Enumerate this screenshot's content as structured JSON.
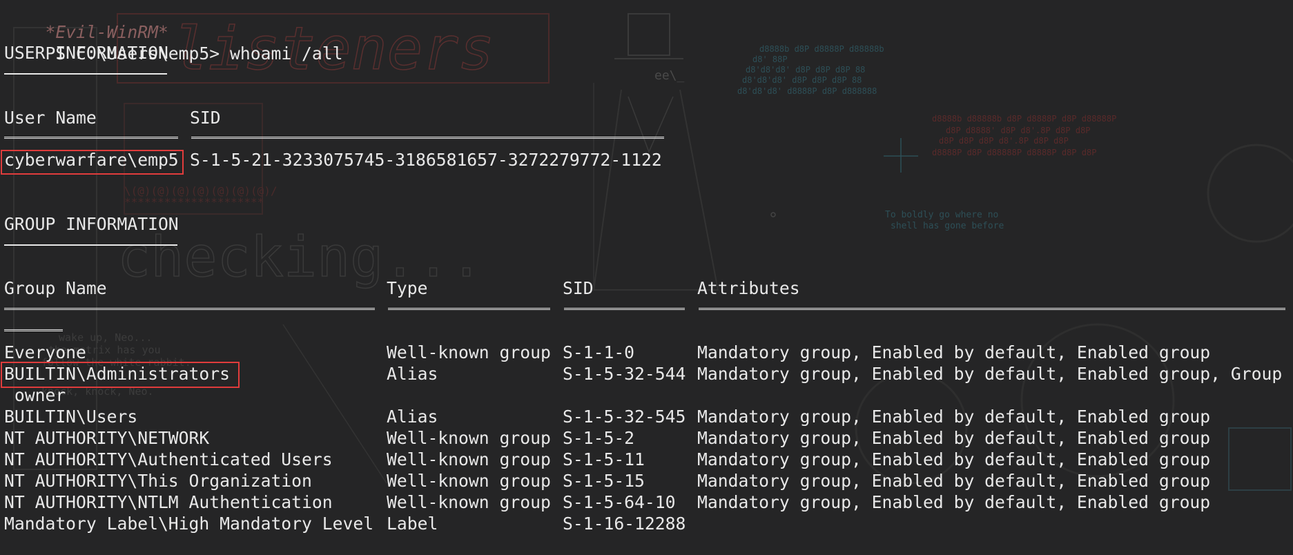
{
  "prompt": {
    "app": "*Evil-WinRM*",
    "ps": "PS C:\\Users\\emp5>",
    "command": " whoami /all"
  },
  "user_info": {
    "heading": "USER INFORMATION",
    "columns": {
      "user_name": "User Name",
      "sid": "SID"
    },
    "row": {
      "user_name": "cyberwarfare\\emp5",
      "sid": "S-1-5-21-3233075745-3186581657-3272279772-1122"
    }
  },
  "group_info": {
    "heading": "GROUP INFORMATION",
    "columns": {
      "group_name": "Group Name",
      "type": "Type",
      "sid": "SID",
      "attributes": "Attributes"
    },
    "rows": [
      {
        "group_name": "Everyone",
        "type": "Well-known group",
        "sid": "S-1-1-0",
        "attributes": "Mandatory group, Enabled by default, Enabled group"
      },
      {
        "group_name": "BUILTIN\\Administrators",
        "type": "Alias",
        "sid": "S-1-5-32-544",
        "attributes": "Mandatory group, Enabled by default, Enabled group, Group",
        "continuation": " owner"
      },
      {
        "group_name": "BUILTIN\\Users",
        "type": "Alias",
        "sid": "S-1-5-32-545",
        "attributes": "Mandatory group, Enabled by default, Enabled group"
      },
      {
        "group_name": "NT AUTHORITY\\NETWORK",
        "type": "Well-known group",
        "sid": "S-1-5-2",
        "attributes": "Mandatory group, Enabled by default, Enabled group"
      },
      {
        "group_name": "NT AUTHORITY\\Authenticated Users",
        "type": "Well-known group",
        "sid": "S-1-5-11",
        "attributes": "Mandatory group, Enabled by default, Enabled group"
      },
      {
        "group_name": "NT AUTHORITY\\This Organization",
        "type": "Well-known group",
        "sid": "S-1-5-15",
        "attributes": "Mandatory group, Enabled by default, Enabled group"
      },
      {
        "group_name": "NT AUTHORITY\\NTLM Authentication",
        "type": "Well-known group",
        "sid": "S-1-5-64-10",
        "attributes": "Mandatory group, Enabled by default, Enabled group"
      },
      {
        "group_name": "Mandatory Label\\High Mandatory Level",
        "type": "Label",
        "sid": "S-1-16-12288",
        "attributes": ""
      }
    ]
  },
  "background_art": {
    "listeners_logo": "listeners",
    "checking_logo": "checking...",
    "matrix_lines": [
      "wake up, Neo...",
      "the matrix has you",
      "follow the white rabbit.",
      "knock, knock, Neo."
    ],
    "tagline": [
      "To boldly go where no",
      "shell has gone before"
    ]
  },
  "colors": {
    "background": "#252526",
    "text": "#e8e8e8",
    "prompt_app": "#8a5f5f",
    "highlight": "#e03c3c"
  }
}
